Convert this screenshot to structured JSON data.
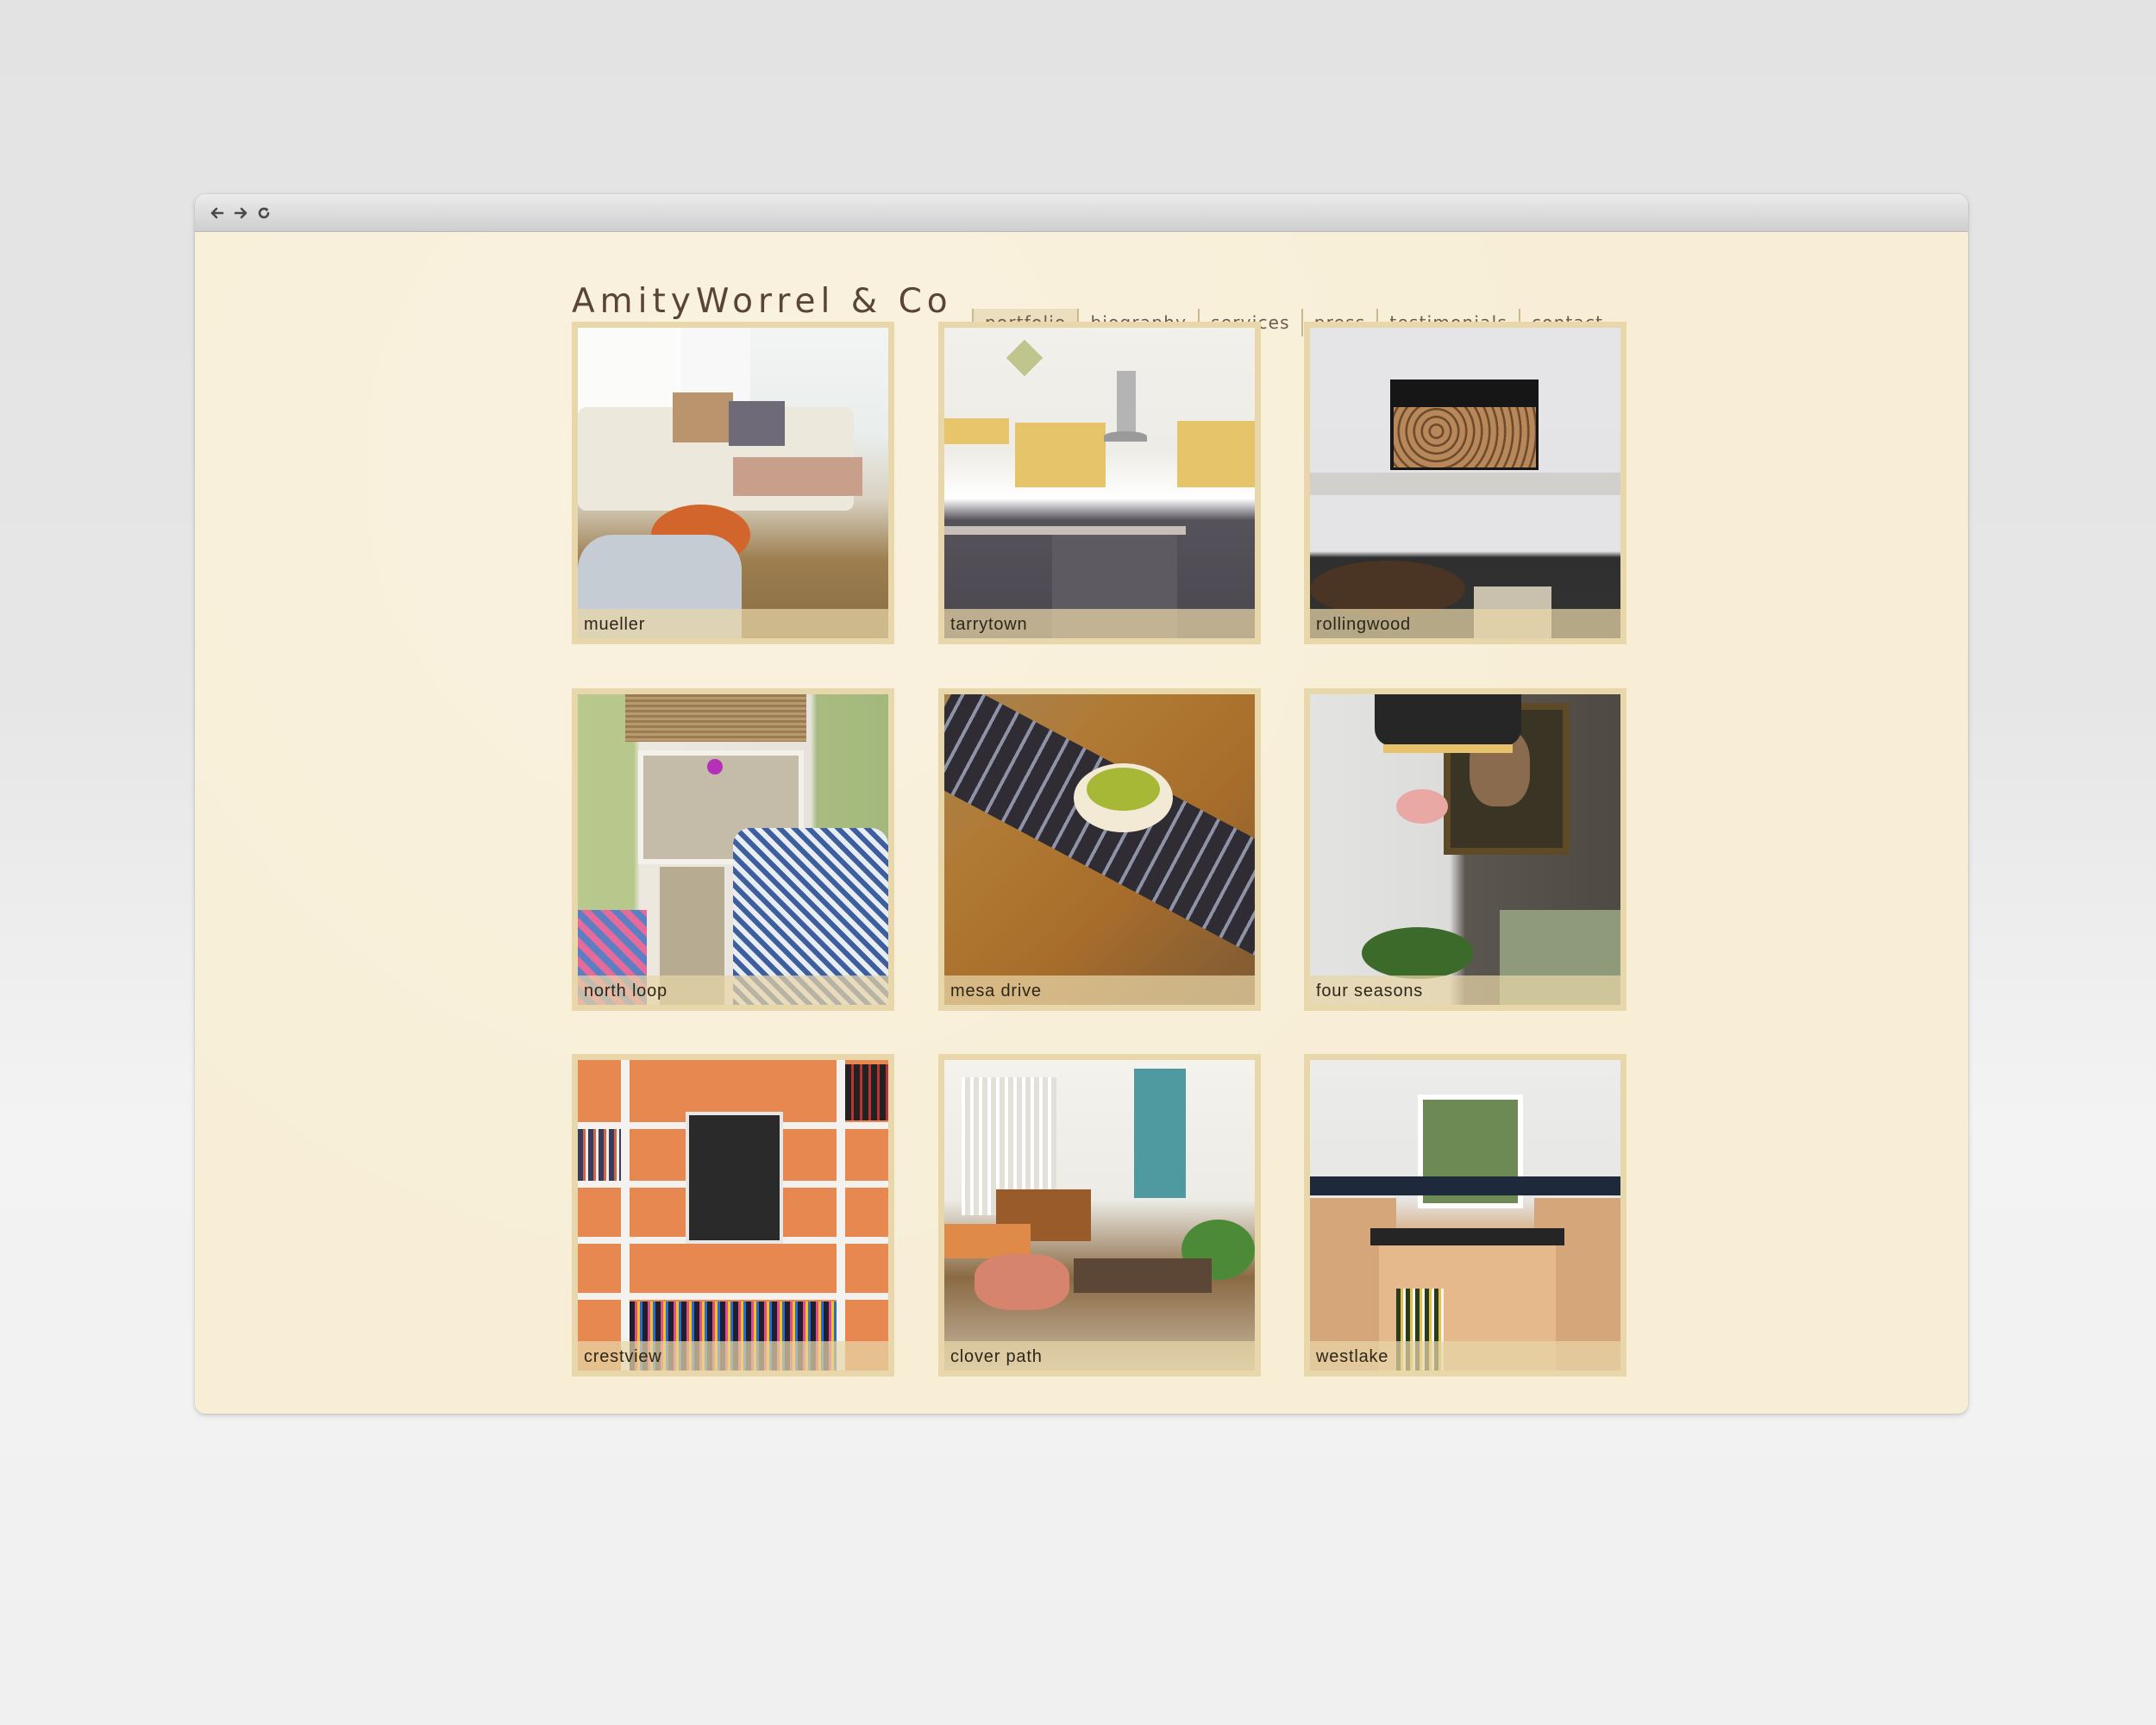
{
  "browser": {
    "back_icon": "arrow-left",
    "forward_icon": "arrow-right",
    "reload_icon": "reload"
  },
  "site": {
    "logo": "AmityWorrel & Co",
    "nav": [
      {
        "label": "portfolio",
        "active": true
      },
      {
        "label": "biography",
        "active": false
      },
      {
        "label": "services",
        "active": false
      },
      {
        "label": "press",
        "active": false
      },
      {
        "label": "testimonials",
        "active": false
      },
      {
        "label": "contact",
        "active": false
      }
    ]
  },
  "portfolio": [
    {
      "label": "mueller",
      "scene": "living room with white sectional sofa and orange side table"
    },
    {
      "label": "tarrytown",
      "scene": "kitchen with yellow upper cabinets and gray island"
    },
    {
      "label": "rollingwood",
      "scene": "white wall with firewood niche and dark table"
    },
    {
      "label": "north loop",
      "scene": "window with orchid and blue patterned armchair"
    },
    {
      "label": "mesa drive",
      "scene": "wooden table with ikat runner and bowl of pears"
    },
    {
      "label": "four seasons",
      "scene": "pendant lamp, orchid and framed dog portrait"
    },
    {
      "label": "crestview",
      "scene": "orange-backed bookshelves with framed Austin map"
    },
    {
      "label": "clover path",
      "scene": "living room with staircase and patterned pillow"
    },
    {
      "label": "westlake",
      "scene": "kitchen with wooden island and window"
    }
  ],
  "colors": {
    "page_bg": "#f8eed6",
    "tile_frame": "#e9d7ac",
    "nav_active_bg": "#ecdfc0",
    "nav_separator": "#cdb78e",
    "logo_text": "#5a4535",
    "nav_text": "#6d5b4b"
  }
}
